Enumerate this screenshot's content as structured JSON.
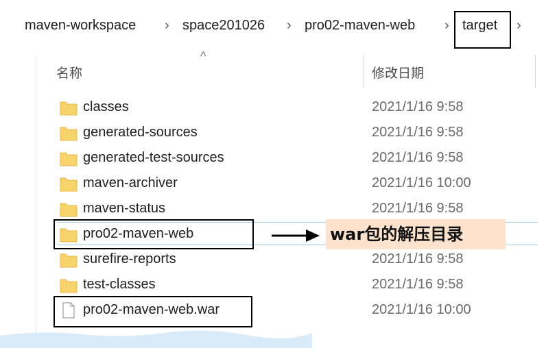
{
  "breadcrumb": {
    "items": [
      "maven-workspace",
      "space201026",
      "pro02-maven-web",
      "target"
    ],
    "separator": "›"
  },
  "columns": {
    "name": "名称",
    "date_modified": "修改日期",
    "sort_indicator": "^"
  },
  "files": [
    {
      "name": "classes",
      "date": "2021/1/16 9:58",
      "type": "folder"
    },
    {
      "name": "generated-sources",
      "date": "2021/1/16 9:58",
      "type": "folder"
    },
    {
      "name": "generated-test-sources",
      "date": "2021/1/16 9:58",
      "type": "folder"
    },
    {
      "name": "maven-archiver",
      "date": "2021/1/16 10:00",
      "type": "folder"
    },
    {
      "name": "maven-status",
      "date": "2021/1/16 9:58",
      "type": "folder"
    },
    {
      "name": "pro02-maven-web",
      "date": "",
      "type": "folder"
    },
    {
      "name": "surefire-reports",
      "date": "2021/1/16 9:58",
      "type": "folder"
    },
    {
      "name": "test-classes",
      "date": "2021/1/16 9:58",
      "type": "folder"
    },
    {
      "name": "pro02-maven-web.war",
      "date": "2021/1/16 10:00",
      "type": "file"
    }
  ],
  "annotation": {
    "text": "war包的解压目录"
  },
  "colors": {
    "folder": "#f6d36b",
    "folder_dark": "#e8b84a",
    "annotation_bg": "#fde3cd",
    "selection_line": "#9ec9ef"
  },
  "icons": {
    "folder": "folder-icon",
    "file": "file-icon",
    "arrow": "arrow-right-icon"
  }
}
